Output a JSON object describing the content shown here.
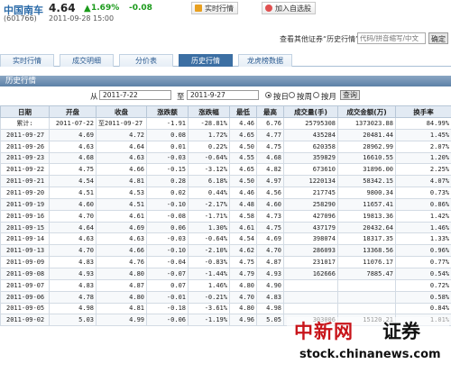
{
  "header": {
    "stock_name": "中国南车",
    "stock_code": "(601766)",
    "price": "4.64",
    "change_pct": "1.69%",
    "change": "-0.08",
    "time": "2011-09-28 15:00",
    "realtime_button": "实时行情",
    "favorite_button": "加入自选股",
    "colors": {
      "up_green": "#1a9a1a",
      "name_blue": "#2a6aa8"
    }
  },
  "search": {
    "label": "查看其他证券“历史行情”",
    "placeholder": "代码/拼音缩写/中文",
    "button": "确定"
  },
  "tabs": [
    {
      "label": "实时行情",
      "active": false
    },
    {
      "label": "成交明细",
      "active": false
    },
    {
      "label": "分价表",
      "active": false
    },
    {
      "label": "历史行情",
      "active": true
    },
    {
      "label": "龙虎榜数据",
      "active": false
    }
  ],
  "section_title": "历史行情",
  "date_filter": {
    "from_label": "从",
    "from_value": "2011-7-22",
    "to_label": "至",
    "to_value": "2011-9-27",
    "options": [
      "按日",
      "按周",
      "按月"
    ],
    "selected": "按日",
    "query_button": "查询"
  },
  "table": {
    "columns": [
      "日期",
      "开盘",
      "收盘",
      "涨跌额",
      "涨跌幅",
      "最低",
      "最高",
      "成交量(手)",
      "成交金额(万)",
      "换手率"
    ],
    "summary": [
      "累计:",
      "2011-07-22",
      "至2011-09-27",
      "-1.91",
      "-28.81%",
      "4.46",
      "6.76",
      "25795308",
      "1373023.88",
      "84.99%"
    ],
    "rows": [
      [
        "2011-09-27",
        "4.69",
        "4.72",
        "0.08",
        "1.72%",
        "4.65",
        "4.77",
        "435284",
        "20481.44",
        "1.45%"
      ],
      [
        "2011-09-26",
        "4.63",
        "4.64",
        "0.01",
        "0.22%",
        "4.50",
        "4.75",
        "620358",
        "28962.99",
        "2.07%"
      ],
      [
        "2011-09-23",
        "4.68",
        "4.63",
        "-0.03",
        "-0.64%",
        "4.55",
        "4.68",
        "359829",
        "16610.55",
        "1.20%"
      ],
      [
        "2011-09-22",
        "4.75",
        "4.66",
        "-0.15",
        "-3.12%",
        "4.65",
        "4.82",
        "673610",
        "31896.00",
        "2.25%"
      ],
      [
        "2011-09-21",
        "4.54",
        "4.81",
        "0.28",
        "6.18%",
        "4.50",
        "4.97",
        "1220134",
        "58342.15",
        "4.07%"
      ],
      [
        "2011-09-20",
        "4.51",
        "4.53",
        "0.02",
        "0.44%",
        "4.46",
        "4.56",
        "217745",
        "9800.34",
        "0.73%"
      ],
      [
        "2011-09-19",
        "4.60",
        "4.51",
        "-0.10",
        "-2.17%",
        "4.48",
        "4.60",
        "258290",
        "11657.41",
        "0.86%"
      ],
      [
        "2011-09-16",
        "4.70",
        "4.61",
        "-0.08",
        "-1.71%",
        "4.58",
        "4.73",
        "427096",
        "19813.36",
        "1.42%"
      ],
      [
        "2011-09-15",
        "4.64",
        "4.69",
        "0.06",
        "1.30%",
        "4.61",
        "4.75",
        "437179",
        "20432.64",
        "1.46%"
      ],
      [
        "2011-09-14",
        "4.63",
        "4.63",
        "-0.03",
        "-0.64%",
        "4.54",
        "4.69",
        "398074",
        "18317.35",
        "1.33%"
      ],
      [
        "2011-09-13",
        "4.70",
        "4.66",
        "-0.10",
        "-2.10%",
        "4.62",
        "4.70",
        "286093",
        "13368.56",
        "0.96%"
      ],
      [
        "2011-09-09",
        "4.83",
        "4.76",
        "-0.04",
        "-0.83%",
        "4.75",
        "4.87",
        "231017",
        "11076.17",
        "0.77%"
      ],
      [
        "2011-09-08",
        "4.93",
        "4.80",
        "-0.07",
        "-1.44%",
        "4.79",
        "4.93",
        "162666",
        "7885.47",
        "0.54%"
      ],
      [
        "2011-09-07",
        "4.83",
        "4.87",
        "0.07",
        "1.46%",
        "4.80",
        "4.90",
        "",
        "",
        "0.72%"
      ],
      [
        "2011-09-06",
        "4.78",
        "4.80",
        "-0.01",
        "-0.21%",
        "4.70",
        "4.83",
        "",
        "",
        "0.58%"
      ],
      [
        "2011-09-05",
        "4.98",
        "4.81",
        "-0.18",
        "-3.61%",
        "4.80",
        "4.98",
        "",
        "",
        "0.84%"
      ],
      [
        "2011-09-02",
        "5.03",
        "4.99",
        "-0.06",
        "-1.19%",
        "4.96",
        "5.05",
        "303006",
        "15120.21",
        "1.01%"
      ]
    ]
  },
  "watermark": {
    "brand_red": "中新网",
    "brand_black": "证券",
    "url": "stock.chinanews.com",
    "color_red": "#c8141a"
  }
}
